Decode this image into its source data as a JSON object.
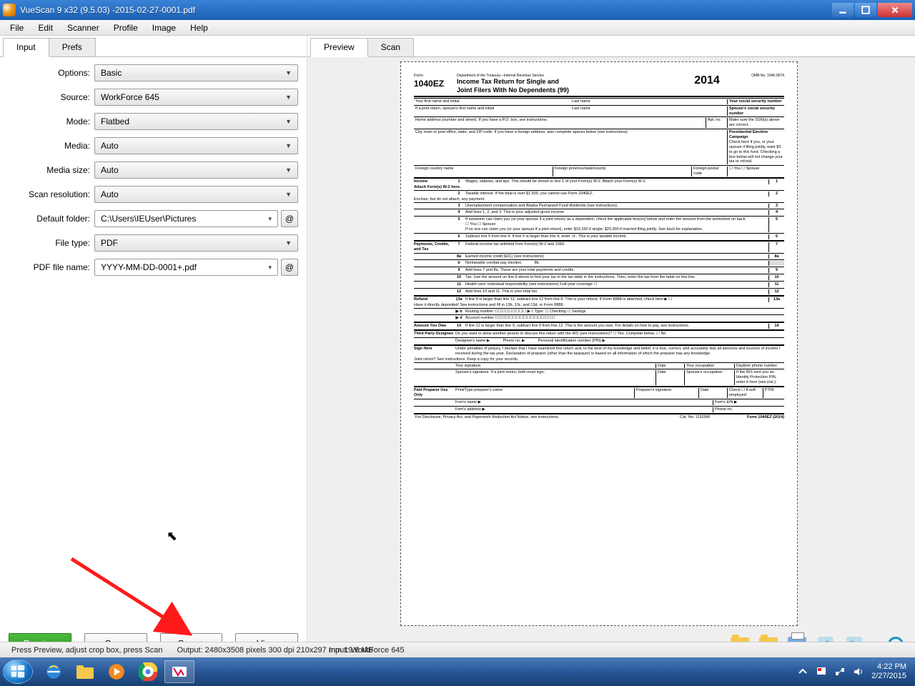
{
  "window": {
    "title": "VueScan 9 x32 (9.5.03) -2015-02-27-0001.pdf"
  },
  "menu": {
    "file": "File",
    "edit": "Edit",
    "scanner": "Scanner",
    "profile": "Profile",
    "image": "Image",
    "help": "Help"
  },
  "left": {
    "tab_input": "Input",
    "tab_prefs": "Prefs",
    "labels": {
      "options": "Options:",
      "source": "Source:",
      "mode": "Mode:",
      "media": "Media:",
      "media_size": "Media size:",
      "scan_res": "Scan resolution:",
      "default_folder": "Default folder:",
      "file_type": "File type:",
      "pdf_name": "PDF file name:"
    },
    "values": {
      "options": "Basic",
      "source": "WorkForce 645",
      "mode": "Flatbed",
      "media": "Auto",
      "media_size": "Auto",
      "scan_res": "Auto",
      "default_folder": "C:\\Users\\IEUser\\Pictures",
      "file_type": "PDF",
      "pdf_name": "YYYY-MM-DD-0001+.pdf"
    },
    "at_symbol": "@"
  },
  "buttons": {
    "preview": "Preview",
    "scan": "Scan",
    "scan_plus": "Scan+",
    "view": "View"
  },
  "right": {
    "tab_preview": "Preview",
    "tab_scan": "Scan"
  },
  "status": {
    "left": "Press Preview, adjust crop box, press Scan",
    "mid": "Input: WorkForce 645",
    "right": "Output: 2480x3508 pixels 300 dpi 210x297 mm 19.6 MB"
  },
  "taskbar": {
    "time": "4:22 PM",
    "date": "2/27/2015"
  },
  "doc": {
    "form_label": "Form",
    "form_no": "1040EZ",
    "dept": "Department of the Treasury—Internal Revenue Service",
    "title1": "Income Tax Return for Single and",
    "title2": "Joint Filers With No Dependents  (99)",
    "year": "2014",
    "omb": "OMB No. 1545-0074",
    "name_first": "Your first name and initial",
    "name_last": "Last name",
    "ssn": "Your social security number",
    "spouse_first": "If a joint return, spouse's first name and initial",
    "spouse_last": "Last name",
    "spouse_ssn": "Spouse's social security number",
    "address": "Home address (number and street). If you have a P.O. box, see instructions.",
    "apt": "Apt. no.",
    "ssn_note": "Make sure the SSN(s) above are correct.",
    "city": "City, town or post office, state, and ZIP code. If you have a foreign address, also complete spaces below (see instructions).",
    "campaign": "Presidential Election Campaign",
    "campaign_txt": "Check here if you, or your spouse if filing jointly, want $3 to go to this fund. Checking a box below will not change your tax or refund.",
    "foreign_country": "Foreign country name",
    "foreign_prov": "Foreign province/state/county",
    "foreign_postal": "Foreign postal code",
    "you": "You",
    "spouse": "Spouse",
    "sec_income": "Income",
    "income_sub": "Attach Form(s) W-2 here.",
    "income_sub2": "Enclose, but do not attach, any payment.",
    "l1": "Wages, salaries, and tips. This should be shown in box 1 of your Form(s) W-2. Attach your Form(s) W-2.",
    "l2": "Taxable interest. If the total is over $1,500, you cannot use Form 1040EZ.",
    "l3": "Unemployment compensation and Alaska Permanent Fund dividends (see instructions).",
    "l4": "Add lines 1, 2, and 3. This is your adjusted gross income.",
    "l5a": "If someone can claim you (or your spouse if a joint return) as a dependent, check the applicable box(es) below and enter the amount from the worksheet on back.",
    "l5b": "☐ You     ☐ Spouse",
    "l5c": "If no one can claim you (or your spouse if a joint return), enter $10,150 if single; $20,300 if married filing jointly. See back for explanation.",
    "l6": "Subtract line 5 from line 4. If line 5 is larger than line 4, enter -0-. This is your taxable income.",
    "sec_payments": "Payments, Credits, and Tax",
    "l7": "Federal income tax withheld from Form(s) W-2 and 1099.",
    "l8a": "Earned income credit (EIC) (see instructions)",
    "l8b": "Nontaxable combat pay election.",
    "l9": "Add lines 7 and 8a. These are your total payments and credits.",
    "l10": "Tax. Use the amount on line 6 above to find your tax in the tax table in the instructions. Then, enter the tax from the table on this line.",
    "l11": "Health care: individual responsibility (see instructions)    Full-year coverage ☐",
    "l12": "Add lines 10 and 11. This is your total tax.",
    "sec_refund": "Refund",
    "refund_sub": "Have it directly deposited! See instructions and fill in 13b, 13c, and 13d, or Form 8888.",
    "l13a": "If line 9 is larger than line 12, subtract line 12 from line 9. This is your refund. If Form 8888 is attached, check here ▶ ☐",
    "l13b": "Routing number  ☐☐☐☐☐☐☐☐☐   ▶ c Type: ☐ Checking ☐ Savings",
    "l13d": "Account number  ☐☐☐☐☐☐☐☐☐☐☐☐☐☐☐☐☐",
    "sec_owe": "Amount You Owe",
    "l14": "If line 12 is larger than line 9, subtract line 9 from line 12. This is the amount you owe. For details on how to pay, see instructions.",
    "sec_third": "Third Party Designee",
    "third_txt": "Do you want to allow another person to discuss this return with the IRS (see instructions)?  ☐ Yes. Complete below.  ☐ No",
    "third_name": "Designee's name ▶",
    "third_phone": "Phone no. ▶",
    "third_pin": "Personal identification number (PIN) ▶",
    "sec_sign": "Sign Here",
    "sign_txt": "Under penalties of perjury, I declare that I have examined this return and, to the best of my knowledge and belief, it is true, correct, and accurately lists all amounts and sources of income I received during the tax year. Declaration of preparer (other than the taxpayer) is based on all information of which the preparer has any knowledge.",
    "sign_joint": "Joint return? See instructions. Keep a copy for your records.",
    "sign_your": "Your signature",
    "sign_date": "Date",
    "sign_occ": "Your occupation",
    "sign_phone": "Daytime phone number",
    "sign_spouse": "Spouse's signature. If a joint return, both must sign.",
    "sign_spouse_occ": "Spouse's occupation",
    "sign_pin": "If the IRS sent you an Identity Protection PIN, enter it here (see inst.)",
    "sec_paid": "Paid Preparer Use Only",
    "paid_name": "Print/Type preparer's name",
    "paid_sig": "Preparer's signature",
    "paid_check": "Check ☐ if self-employed",
    "paid_ptin": "PTIN",
    "paid_firm": "Firm's name ▶",
    "paid_ein": "Firm's EIN ▶",
    "paid_addr": "Firm's address ▶",
    "paid_phone": "Phone no.",
    "footer": "For Disclosure, Privacy Act, and Paperwork Reduction Act Notice, see instructions.",
    "cat": "Cat. No. 11329W",
    "footer_form": "Form 1040EZ (2014)"
  }
}
